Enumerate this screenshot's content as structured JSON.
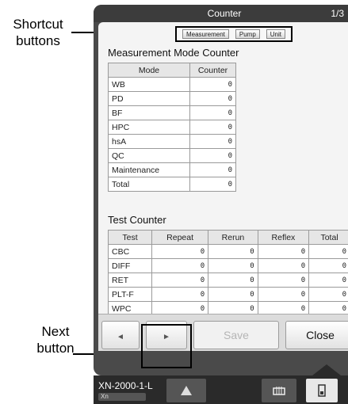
{
  "annotations": {
    "shortcut": "Shortcut\nbuttons",
    "next": "Next\nbutton"
  },
  "window": {
    "title": "Counter",
    "page": "1/3"
  },
  "shortcuts": [
    "Measurement",
    "Pump",
    "Unit"
  ],
  "measurement": {
    "title": "Measurement Mode Counter",
    "headers": [
      "Mode",
      "Counter"
    ],
    "rows": [
      [
        "WB",
        "0"
      ],
      [
        "PD",
        "0"
      ],
      [
        "BF",
        "0"
      ],
      [
        "HPC",
        "0"
      ],
      [
        "hsA",
        "0"
      ],
      [
        "QC",
        "0"
      ],
      [
        "Maintenance",
        "0"
      ],
      [
        "Total",
        "0"
      ]
    ]
  },
  "test": {
    "title": "Test Counter",
    "headers": [
      "Test",
      "Repeat",
      "Rerun",
      "Reflex",
      "Total"
    ],
    "rows": [
      [
        "CBC",
        "0",
        "0",
        "0",
        "0"
      ],
      [
        "DIFF",
        "0",
        "0",
        "0",
        "0"
      ],
      [
        "RET",
        "0",
        "0",
        "0",
        "0"
      ],
      [
        "PLT-F",
        "0",
        "0",
        "0",
        "0"
      ],
      [
        "WPC",
        "0",
        "0",
        "0",
        "0"
      ]
    ]
  },
  "buttons": {
    "prev": "◄",
    "next": "►",
    "save": "Save",
    "close": "Close"
  },
  "status": {
    "model": "XN-2000-1-L",
    "mini": "Xn"
  },
  "icons": {
    "warning": "warning-icon",
    "grid": "rack-icon",
    "device": "device-icon"
  }
}
